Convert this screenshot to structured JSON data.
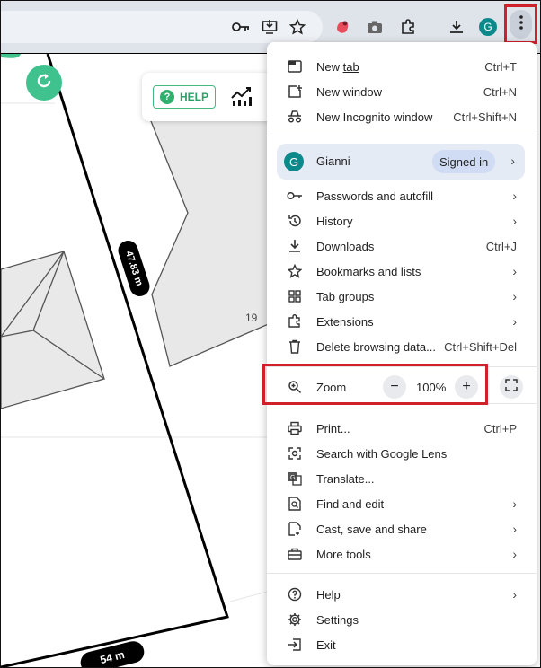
{
  "toolbar": {
    "icons": [
      "key-icon",
      "install-icon",
      "star-icon",
      "extension-red-icon",
      "camera-icon",
      "puzzle-icon",
      "download-icon"
    ],
    "avatar_letter": "G",
    "menu_button_icon": "kebab-icon"
  },
  "map": {
    "help_label": "HELP",
    "measure_top": "47.83 m",
    "measure_bottom": "54 m",
    "lot_number": "19"
  },
  "menu": {
    "new_tab": {
      "label": "New tab",
      "shortcut": "Ctrl+T"
    },
    "new_window": {
      "label": "New window",
      "shortcut": "Ctrl+N"
    },
    "new_incognito": {
      "label": "New Incognito window",
      "shortcut": "Ctrl+Shift+N"
    },
    "profile": {
      "avatar_letter": "G",
      "name": "Gianni",
      "status": "Signed in"
    },
    "passwords": {
      "label": "Passwords and autofill"
    },
    "history": {
      "label": "History"
    },
    "downloads": {
      "label": "Downloads",
      "shortcut": "Ctrl+J"
    },
    "bookmarks": {
      "label": "Bookmarks and lists"
    },
    "tab_groups": {
      "label": "Tab groups"
    },
    "extensions": {
      "label": "Extensions"
    },
    "delete_data": {
      "label": "Delete browsing data...",
      "shortcut": "Ctrl+Shift+Del"
    },
    "zoom": {
      "label": "Zoom",
      "value": "100%",
      "minus": "−",
      "plus": "+"
    },
    "print": {
      "label": "Print...",
      "shortcut": "Ctrl+P"
    },
    "google_lens": {
      "label": "Search with Google Lens"
    },
    "translate": {
      "label": "Translate..."
    },
    "find_edit": {
      "label": "Find and edit"
    },
    "cast_save": {
      "label": "Cast, save and share"
    },
    "more_tools": {
      "label": "More tools"
    },
    "help": {
      "label": "Help"
    },
    "settings": {
      "label": "Settings"
    },
    "exit": {
      "label": "Exit"
    }
  },
  "colors": {
    "highlight_border": "#d0202a",
    "profile_bg": "#e5ebf5",
    "fab_green": "#3fc28e"
  }
}
